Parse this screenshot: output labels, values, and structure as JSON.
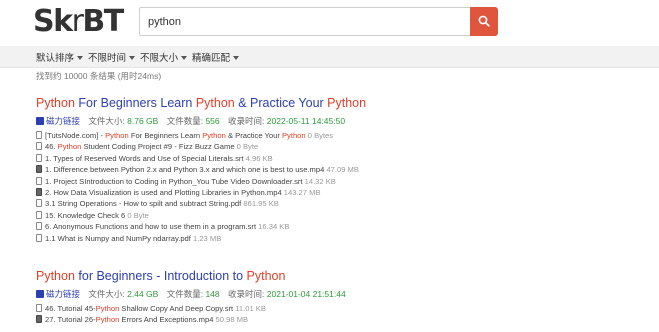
{
  "logo": {
    "a": "Sk",
    "b": "r",
    "c": "BT"
  },
  "search": {
    "value": "python"
  },
  "filters": [
    "默认排序",
    "不限时间",
    "不限大小",
    "精确匹配"
  ],
  "result_count": "找到约 10000 条结果 (用时24ms)",
  "results": [
    {
      "title": [
        {
          "t": "Python",
          "hl": true
        },
        {
          "t": " For Beginners Learn ",
          "hl": false
        },
        {
          "t": "Python",
          "hl": true
        },
        {
          "t": " & Practice Your ",
          "hl": false
        },
        {
          "t": "Python",
          "hl": true
        }
      ],
      "magnet_label": "磁力链接",
      "size_label": "文件大小:",
      "size": "8.76 GB",
      "count_label": "文件数量:",
      "count": "556",
      "date_label": "收录时间:",
      "date": "2022-05-11 14:45:50",
      "files": [
        {
          "icon": "doc",
          "parts": [
            {
              "t": "[TutsNode.com] - ",
              "hl": false
            },
            {
              "t": "Python",
              "hl": true
            },
            {
              "t": " For Beginners Learn ",
              "hl": false
            },
            {
              "t": "Python",
              "hl": true
            },
            {
              "t": " & Practice Your ",
              "hl": false
            },
            {
              "t": "Python",
              "hl": true
            },
            {
              "t": " 0 Bytes",
              "hl": false,
              "size": true
            }
          ]
        },
        {
          "icon": "doc",
          "parts": [
            {
              "t": "46. ",
              "hl": false
            },
            {
              "t": "Python",
              "hl": true
            },
            {
              "t": " Student Coding Project #9 - Fizz Buzz Game",
              "hl": false
            },
            {
              "t": " 0 Byte",
              "hl": false,
              "size": true
            }
          ]
        },
        {
          "icon": "doc",
          "parts": [
            {
              "t": "1. Types of Reserved Words and Use of Special Literals.srt",
              "hl": false
            },
            {
              "t": " 4.96 KB",
              "hl": false,
              "size": true
            }
          ]
        },
        {
          "icon": "video",
          "parts": [
            {
              "t": "1. Difference between Python 2.x and Python 3.x and which one is best to use.mp4",
              "hl": false
            },
            {
              "t": " 47.09 MB",
              "hl": false,
              "size": true
            }
          ]
        },
        {
          "icon": "doc",
          "parts": [
            {
              "t": "1. Project SIntroduction to Coding in Python_You Tube Video Downloader.srt",
              "hl": false
            },
            {
              "t": " 14.32 KB",
              "hl": false,
              "size": true
            }
          ]
        },
        {
          "icon": "video",
          "parts": [
            {
              "t": "2. How Data Visualization is used and Plotting Libraries in Python.mp4",
              "hl": false
            },
            {
              "t": " 143.27 MB",
              "hl": false,
              "size": true
            }
          ]
        },
        {
          "icon": "doc",
          "parts": [
            {
              "t": "3.1 String Operations - How to spilt and subtract String.pdf",
              "hl": false
            },
            {
              "t": " 861.95 KB",
              "hl": false,
              "size": true
            }
          ]
        },
        {
          "icon": "doc",
          "parts": [
            {
              "t": "15. Knowledge Check 6",
              "hl": false
            },
            {
              "t": " 0 Byte",
              "hl": false,
              "size": true
            }
          ]
        },
        {
          "icon": "doc",
          "parts": [
            {
              "t": "6. Anonymous Functions and how to use them in a program.srt",
              "hl": false
            },
            {
              "t": " 16.34 KB",
              "hl": false,
              "size": true
            }
          ]
        },
        {
          "icon": "doc",
          "parts": [
            {
              "t": "1.1 What is Numpy and NumPy ndarray.pdf",
              "hl": false
            },
            {
              "t": " 1.23 MB",
              "hl": false,
              "size": true
            }
          ]
        }
      ]
    },
    {
      "title": [
        {
          "t": "Python",
          "hl": true
        },
        {
          "t": " for Beginners - Introduction to ",
          "hl": false
        },
        {
          "t": "Python",
          "hl": true
        }
      ],
      "magnet_label": "磁力链接",
      "size_label": "文件大小:",
      "size": "2.44 GB",
      "count_label": "文件数量:",
      "count": "148",
      "date_label": "收录时间:",
      "date": "2021-01-04 21:51:44",
      "files": [
        {
          "icon": "doc",
          "parts": [
            {
              "t": "46. Tutorial 45-",
              "hl": false
            },
            {
              "t": "Python",
              "hl": true
            },
            {
              "t": " Shallow Copy And Deep Copy.srt",
              "hl": false
            },
            {
              "t": " 11.01 KB",
              "hl": false,
              "size": true
            }
          ]
        },
        {
          "icon": "video",
          "parts": [
            {
              "t": "27. Tutorial 26-",
              "hl": false
            },
            {
              "t": "Python",
              "hl": true
            },
            {
              "t": " Errors And Exceptions.mp4",
              "hl": false
            },
            {
              "t": " 50.98 MB",
              "hl": false,
              "size": true
            }
          ]
        }
      ]
    }
  ],
  "colors": {
    "accent": "#e0553d",
    "link": "#2d3fb0",
    "highlight": "#e0402a",
    "size": "#2e9b3a"
  }
}
